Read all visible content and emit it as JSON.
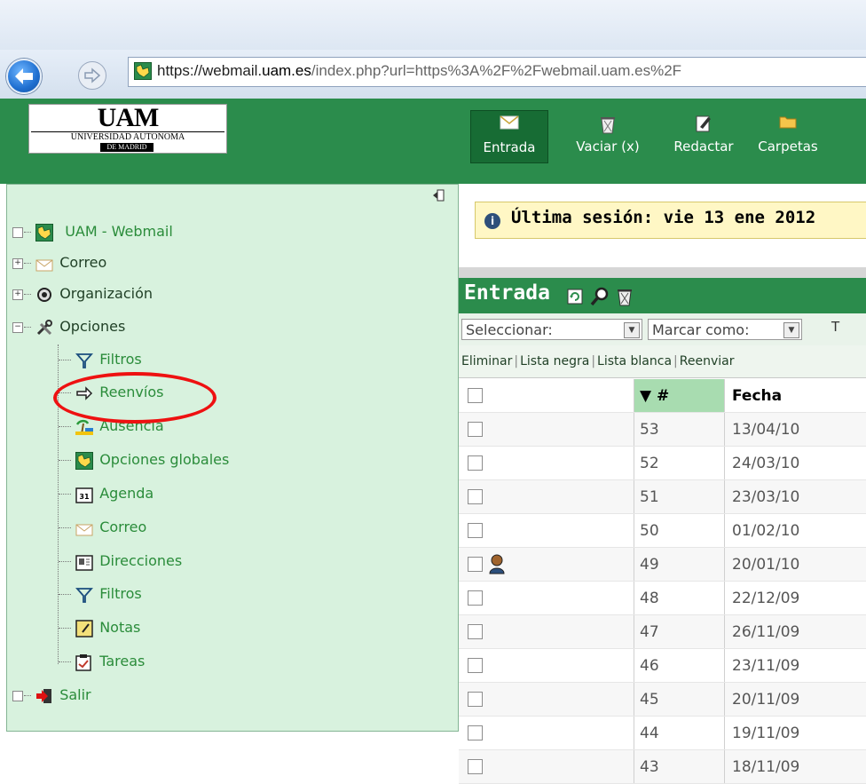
{
  "browser": {
    "url_host_prefix": "https://webmail.",
    "url_host_bold": "uam.es",
    "url_rest": "/index.php?url=https%3A%2F%2Fwebmail.uam.es%2F"
  },
  "logo": {
    "big": "UAM",
    "line1": "UNIVERSIDAD  AUTONOMA",
    "line2": "DE MADRID"
  },
  "toolbar": {
    "entrada": "Entrada",
    "vaciar": "Vaciar (x)",
    "redactar": "Redactar",
    "carpetas": "Carpetas"
  },
  "tree": {
    "root": "UAM - Webmail",
    "correo": "Correo",
    "organizacion": "Organización",
    "opciones": "Opciones",
    "children": {
      "filtros1": "Filtros",
      "reenvios": "Reenvíos",
      "ausencia": "Ausencia",
      "opciones_globales": "Opciones globales",
      "agenda": "Agenda",
      "correo": "Correo",
      "direcciones": "Direcciones",
      "filtros2": "Filtros",
      "notas": "Notas",
      "tareas": "Tareas"
    },
    "salir": "Salir"
  },
  "session": {
    "text": "Última sesión: vie 13 ene 2012"
  },
  "mailbox": {
    "title": "Entrada",
    "select_label": "Seleccionar:",
    "mark_label": "Marcar como:",
    "extra_label": "T",
    "actions": [
      "Eliminar",
      "Lista negra",
      "Lista blanca",
      "Reenviar"
    ],
    "col_num": "▼ #",
    "col_date": "Fecha",
    "rows": [
      {
        "num": "53",
        "date": "13/04/10"
      },
      {
        "num": "52",
        "date": "24/03/10"
      },
      {
        "num": "51",
        "date": "23/03/10"
      },
      {
        "num": "50",
        "date": "01/02/10"
      },
      {
        "num": "49",
        "date": "20/01/10"
      },
      {
        "num": "48",
        "date": "22/12/09"
      },
      {
        "num": "47",
        "date": "26/11/09"
      },
      {
        "num": "46",
        "date": "23/11/09"
      },
      {
        "num": "45",
        "date": "20/11/09"
      },
      {
        "num": "44",
        "date": "19/11/09"
      },
      {
        "num": "43",
        "date": "18/11/09"
      }
    ]
  },
  "colors": {
    "header_green": "#2b8c4c",
    "panel_green": "#d8f2de",
    "highlight_red": "#e11111"
  }
}
